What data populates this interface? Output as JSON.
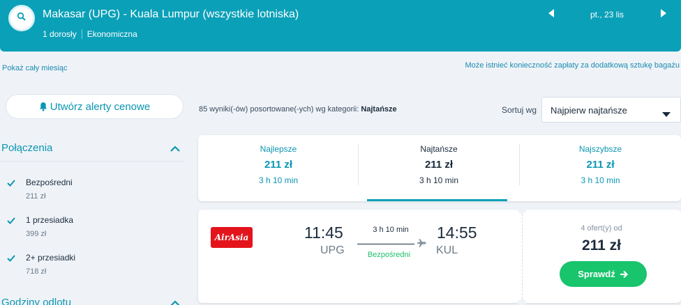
{
  "header": {
    "route_title": "Makasar (UPG) - Kuala Lumpur (wszystkie lotniska)",
    "passengers": "1 dorosły",
    "cabin": "Ekonomiczna",
    "date": "pt., 23 lis",
    "search_icon": "search-icon",
    "prev_icon": "triangle-left-icon",
    "next_icon": "triangle-right-icon"
  },
  "links": {
    "show_month": "Pokaż cały miesiąc",
    "baggage_note": "Może istnieć konieczność zapłaty za dodatkową sztukę bagażu"
  },
  "alert_button": {
    "label": "Utwórz alerty cenowe",
    "icon": "bell-icon"
  },
  "filters": {
    "connections_title": "Połączenia",
    "items": [
      {
        "label": "Bezpośredni",
        "price": "211 zł",
        "checked": true
      },
      {
        "label": "1 przesiadka",
        "price": "399 zł",
        "checked": true
      },
      {
        "label": "2+ przesiadki",
        "price": "718 zł",
        "checked": true
      }
    ],
    "departure_title": "Godziny odlotu"
  },
  "results": {
    "count_text": "85 wyniki(-ów) posortowane(-ych) wg kategorii:",
    "count_sort": "Najtańsze",
    "sort_label": "Sortuj wg",
    "sort_value": "Najpierw najtańsze"
  },
  "tabs": [
    {
      "name": "Najlepsze",
      "price": "211 zł",
      "duration": "3 h 10 min",
      "active": false
    },
    {
      "name": "Najtańsze",
      "price": "211 zł",
      "duration": "3 h 10 min",
      "active": true
    },
    {
      "name": "Najszybsze",
      "price": "211 zł",
      "duration": "3 h 10 min",
      "active": false
    }
  ],
  "flight": {
    "airline_logo_text": "AirAsia",
    "departure_time": "11:45",
    "departure_code": "UPG",
    "arrival_time": "14:55",
    "arrival_code": "KUL",
    "duration": "3 h 10 min",
    "stops": "Bezpośredni",
    "offers": "4 ofert(y) od",
    "price": "211 zł",
    "cta": "Sprawdź"
  },
  "colors": {
    "brand": "#0aa0b8",
    "link": "#1a8bb0",
    "cta": "#18c46c",
    "airline": "#e3141c",
    "direct": "#1fbf6a"
  }
}
